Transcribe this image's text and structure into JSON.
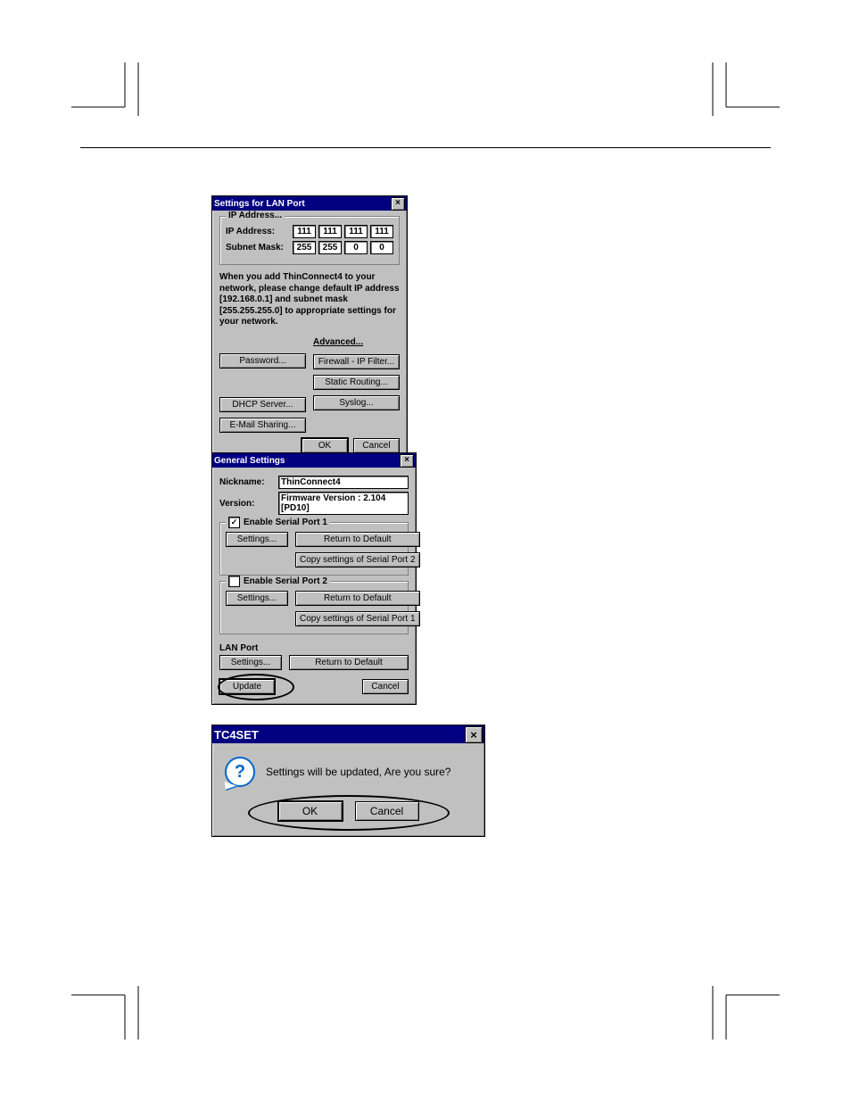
{
  "lan": {
    "title": "Settings for LAN Port",
    "group_ip_title": "IP Address...",
    "ip_label": "IP Address:",
    "subnet_label": "Subnet Mask:",
    "ip": [
      "111",
      "111",
      "111",
      "111"
    ],
    "subnet": [
      "255",
      "255",
      "0",
      "0"
    ],
    "hint": "When you add ThinConnect4 to your network, please change default IP address [192.168.0.1] and subnet mask [255.255.255.0] to appropriate settings for your network.",
    "password_btn": "Password...",
    "dhcp_btn": "DHCP Server...",
    "email_btn": "E-Mail Sharing...",
    "advanced_label": "Advanced...",
    "firewall_btn": "Firewall - IP Filter...",
    "static_btn": "Static Routing...",
    "syslog_btn": "Syslog...",
    "ok_btn": "OK",
    "cancel_btn": "Cancel"
  },
  "general": {
    "title": "General Settings",
    "nickname_label": "Nickname:",
    "nickname_value": "ThinConnect4",
    "version_label": "Version:",
    "version_value": "Firmware Version : 2.104  [PD10]",
    "sp1": {
      "enable_label": "Enable Serial Port 1",
      "checked": true,
      "settings_btn": "Settings...",
      "return_btn": "Return to Default",
      "copy_btn": "Copy settings of Serial Port 2"
    },
    "sp2": {
      "enable_label": "Enable Serial Port 2",
      "checked": false,
      "settings_btn": "Settings...",
      "return_btn": "Return to Default",
      "copy_btn": "Copy settings of Serial Port 1"
    },
    "lanport": {
      "label": "LAN Port",
      "settings_btn": "Settings...",
      "return_btn": "Return to Default"
    },
    "update_btn": "Update",
    "cancel_btn": "Cancel"
  },
  "confirm": {
    "title": "TC4SET",
    "message": "Settings will be updated, Are you sure?",
    "ok_btn": "OK",
    "cancel_btn": "Cancel"
  }
}
